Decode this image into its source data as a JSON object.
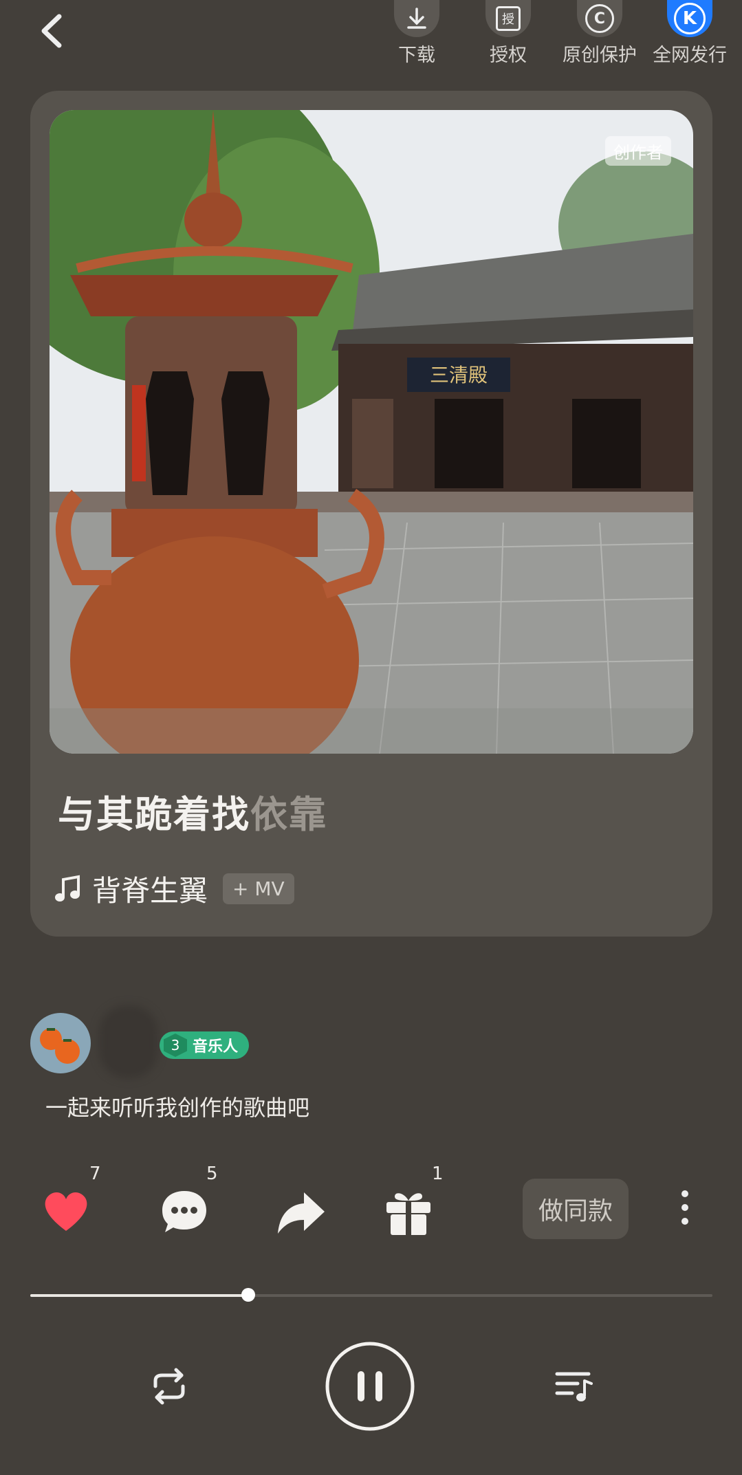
{
  "top_bar": {
    "back": "back-icon",
    "items": [
      {
        "label": "下载",
        "icon": "download-icon"
      },
      {
        "label": "授权",
        "icon": "authorize-icon",
        "glyph": "授"
      },
      {
        "label": "原创保护",
        "icon": "copyright-icon",
        "glyph": "C"
      },
      {
        "label": "全网发行",
        "icon": "k-logo-icon",
        "glyph": "K"
      }
    ]
  },
  "card": {
    "watermark": "创作者",
    "title_main": "与其跪着找",
    "title_fade": "依靠",
    "song_name": "背脊生翼",
    "mv_label": "+ MV",
    "plaque_text": "三清殿"
  },
  "user": {
    "badge_level": "3",
    "badge_label": "音乐人",
    "description": "一起来听听我创作的歌曲吧"
  },
  "actions": {
    "like_count": "7",
    "comment_count": "5",
    "gift_count": "1",
    "same_button": "做同款"
  },
  "player": {
    "progress": 0.32
  },
  "colors": {
    "background": "#433f3a",
    "card": "#57534d",
    "like": "#ff4b5c",
    "badge": "#2fb07e",
    "brand_blue": "#1f7bff"
  }
}
